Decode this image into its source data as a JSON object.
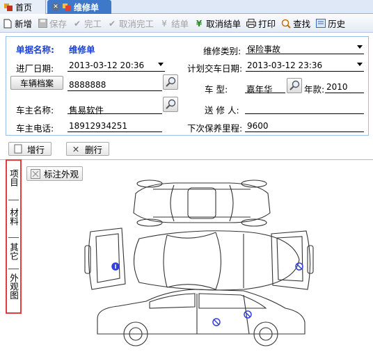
{
  "tabs": [
    {
      "label": "首页",
      "active": false
    },
    {
      "label": "维修单",
      "active": true
    }
  ],
  "toolbar": {
    "new": "新增",
    "save": "保存",
    "finish": "完工",
    "cancel_finish": "取消完工",
    "settle": "结单",
    "cancel_settle": "取消结单",
    "print": "打印",
    "find": "查找",
    "history": "历史"
  },
  "form": {
    "doc_name_label": "单据名称:",
    "doc_name_value": "维修单",
    "repair_type_label": "维修类别:",
    "repair_type_value": "保险事故",
    "entry_date_label": "进厂日期:",
    "entry_date_value": "2013-03-12 20:36",
    "planned_date_label": "计划交车日期:",
    "planned_date_value": "2013-03-12 23:36",
    "vehicle_archive_button": "车辆档案",
    "plate_value": "8888888",
    "model_label": "车    型:",
    "model_value": "嘉年华",
    "year_label": "年款:",
    "year_value": "2010",
    "owner_label": "车主名称:",
    "owner_value": "售易软件",
    "sender_label": "送 修 人:",
    "sender_value": "",
    "phone_label": "车主电话:",
    "phone_value": "18912934251",
    "next_mileage_label": "下次保养里程:",
    "next_mileage_value": "9600"
  },
  "row_buttons": {
    "add": "增行",
    "delete": "删行"
  },
  "side_tabs": [
    "项目",
    "材料",
    "其它",
    "外观图"
  ],
  "mark_button": "标注外观",
  "colors": {
    "accent": "#1a3fd6",
    "tab_active": "#3e78c8",
    "highlight": "#e23c3c",
    "marker": "#3340e0"
  }
}
